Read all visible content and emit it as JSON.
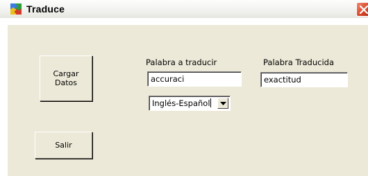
{
  "window": {
    "title": "Traduce",
    "icon": "puzzle-app-icon",
    "close_icon": "close-icon"
  },
  "buttons": {
    "load_data_label": "Cargar\nDatos",
    "exit_label": "Salir"
  },
  "fields": {
    "source_word": {
      "label": "Palabra a traducir",
      "value": "accuraci"
    },
    "translated_word": {
      "label": "Palabra Traducida",
      "value": "exactitud"
    }
  },
  "language_select": {
    "selected": "Inglés-Español"
  },
  "colors": {
    "window_bg": "#ece9d8",
    "close_button": "#d9482a"
  }
}
